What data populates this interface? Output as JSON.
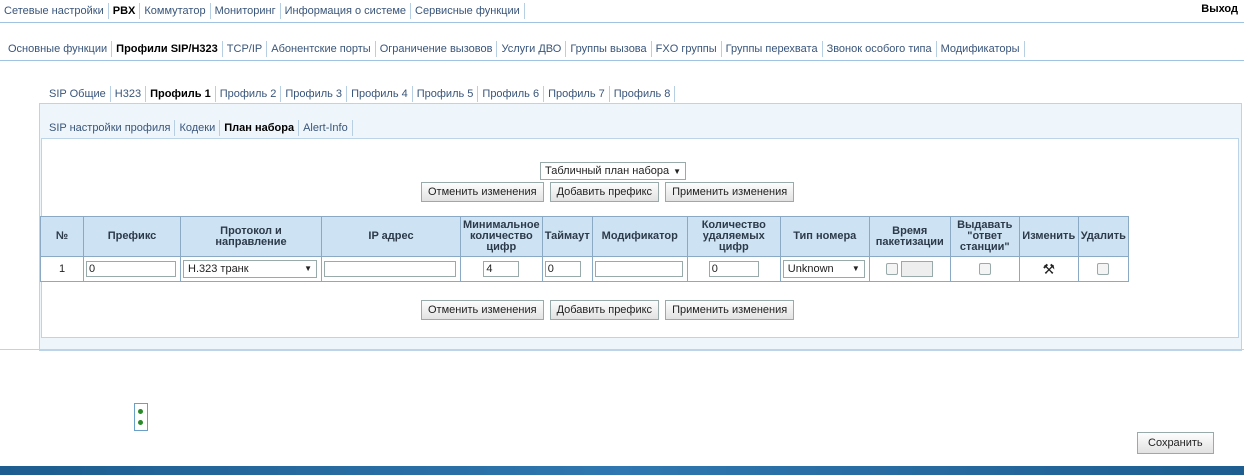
{
  "topnav": {
    "tabs": [
      "Сетевые настройки",
      "PBX",
      "Коммутатор",
      "Мониторинг",
      "Информация о системе",
      "Сервисные функции"
    ],
    "active": 1,
    "exit": "Выход"
  },
  "subnav": {
    "tabs": [
      "Основные функции",
      "Профили SIP/H323",
      "TCP/IP",
      "Абонентские порты",
      "Ограничение вызовов",
      "Услуги ДВО",
      "Группы вызова",
      "FXO группы",
      "Группы перехвата",
      "Звонок особого типа",
      "Модификаторы"
    ],
    "active": 1
  },
  "profiles": {
    "tabs": [
      "SIP Общие",
      "H323",
      "Профиль 1",
      "Профиль 2",
      "Профиль 3",
      "Профиль 4",
      "Профиль 5",
      "Профиль 6",
      "Профиль 7",
      "Профиль 8"
    ],
    "active": 2
  },
  "profile_tabs": {
    "tabs": [
      "SIP настройки профиля",
      "Кодеки",
      "План набора",
      "Alert-Info"
    ],
    "active": 2
  },
  "dialplan_type": "Табличный план набора",
  "buttons": {
    "cancel": "Отменить изменения",
    "add": "Добавить префикс",
    "apply": "Применить изменения",
    "save": "Сохранить"
  },
  "table": {
    "headers": [
      "№",
      "Префикс",
      "Протокол и направление",
      "IP адрес",
      "Минимальное количество цифр",
      "Таймаут",
      "Модификатор",
      "Количество удаляемых цифр",
      "Тип номера",
      "Время пакетизации",
      "Выдавать \"ответ станции\"",
      "Изменить",
      "Удалить"
    ],
    "rows": [
      {
        "num": "1",
        "prefix": "0",
        "protocol": "H.323 транк",
        "ip": "",
        "min_digits": "4",
        "timeout": "0",
        "modifier": "",
        "delete_digits": "0",
        "number_type": "Unknown",
        "edit_icon": "tools-icon"
      }
    ]
  }
}
